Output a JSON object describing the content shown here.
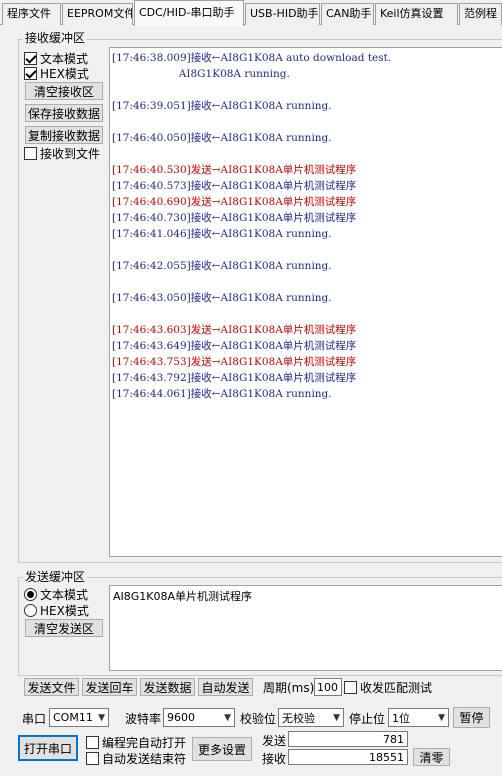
{
  "tabs": [
    {
      "label": "程序文件",
      "active": false
    },
    {
      "label": "EEPROM文件",
      "active": false
    },
    {
      "label": "CDC/HID-串口助手",
      "active": true
    },
    {
      "label": "USB-HID助手",
      "active": false
    },
    {
      "label": "CAN助手",
      "active": false
    },
    {
      "label": "Keil仿真设置",
      "active": false
    },
    {
      "label": "范例程",
      "active": false
    }
  ],
  "receive": {
    "group_title": "接收缓冲区",
    "text_mode_label": "文本模式",
    "text_mode_checked": true,
    "hex_mode_label": "HEX模式",
    "hex_mode_checked": true,
    "clear_label": "清空接收区",
    "save_label": "保存接收数据",
    "copy_label": "复制接收数据",
    "to_file_label": "接收到文件",
    "to_file_checked": false,
    "lines": [
      {
        "text": "[17:46:38.009]接收←AI8G1K08A auto download test.",
        "type": "recv"
      },
      {
        "text": "                    AI8G1K08A running.",
        "type": "recv"
      },
      {
        "text": "",
        "type": "blank"
      },
      {
        "text": "[17:46:39.051]接收←AI8G1K08A running.",
        "type": "recv"
      },
      {
        "text": "",
        "type": "blank"
      },
      {
        "text": "[17:46:40.050]接收←AI8G1K08A running.",
        "type": "recv"
      },
      {
        "text": "",
        "type": "blank"
      },
      {
        "text": "[17:46:40.530]发送→AI8G1K08A单片机测试程序",
        "type": "send"
      },
      {
        "text": "[17:46:40.573]接收←AI8G1K08A单片机测试程序",
        "type": "recv"
      },
      {
        "text": "[17:46:40.690]发送→AI8G1K08A单片机测试程序",
        "type": "send"
      },
      {
        "text": "[17:46:40.730]接收←AI8G1K08A单片机测试程序",
        "type": "recv"
      },
      {
        "text": "[17:46:41.046]接收←AI8G1K08A running.",
        "type": "recv"
      },
      {
        "text": "",
        "type": "blank"
      },
      {
        "text": "[17:46:42.055]接收←AI8G1K08A running.",
        "type": "recv"
      },
      {
        "text": "",
        "type": "blank"
      },
      {
        "text": "[17:46:43.050]接收←AI8G1K08A running.",
        "type": "recv"
      },
      {
        "text": "",
        "type": "blank"
      },
      {
        "text": "[17:46:43.603]发送→AI8G1K08A单片机测试程序",
        "type": "send"
      },
      {
        "text": "[17:46:43.649]接收←AI8G1K08A单片机测试程序",
        "type": "recv"
      },
      {
        "text": "[17:46:43.753]发送→AI8G1K08A单片机测试程序",
        "type": "send"
      },
      {
        "text": "[17:46:43.792]接收←AI8G1K08A单片机测试程序",
        "type": "recv"
      },
      {
        "text": "[17:46:44.061]接收←AI8G1K08A running.",
        "type": "recv"
      }
    ]
  },
  "send": {
    "group_title": "发送缓冲区",
    "text_mode_label": "文本模式",
    "text_mode_selected": true,
    "hex_mode_label": "HEX模式",
    "hex_mode_selected": false,
    "clear_label": "清空发送区",
    "content": "AI8G1K08A单片机测试程序"
  },
  "actions": {
    "send_file": "发送文件",
    "send_enter": "发送回车",
    "send_data": "发送数据",
    "auto_send": "自动发送",
    "period_label": "周期(ms)",
    "period_value": "100",
    "match_test_label": "收发匹配测试",
    "match_test_checked": false
  },
  "serial": {
    "port_label": "串口",
    "port_value": "COM11",
    "baud_label": "波特率",
    "baud_value": "9600",
    "parity_label": "校验位",
    "parity_value": "无校验",
    "stop_label": "停止位",
    "stop_value": "1位",
    "pause_label": "暂停",
    "open_label": "打开串口",
    "auto_open_label": "编程完自动打开",
    "auto_open_checked": false,
    "auto_end_label": "自动发送结束符",
    "auto_end_checked": false,
    "more_label": "更多设置",
    "sent_label": "发送",
    "sent_count": "781",
    "recv_label": "接收",
    "recv_count": "18551",
    "clear_count_label": "清零"
  }
}
